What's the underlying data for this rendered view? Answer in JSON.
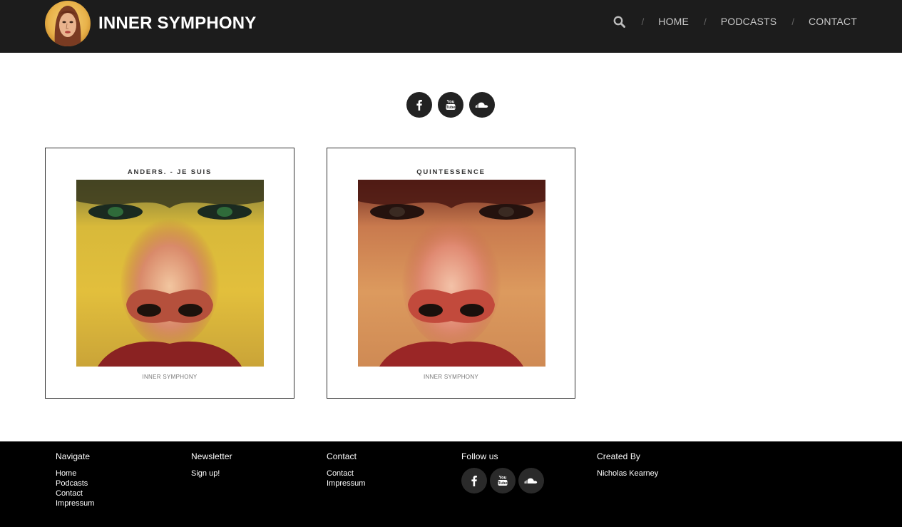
{
  "header": {
    "brand": "INNER SYMPHONY",
    "nav": {
      "home": "HOME",
      "podcasts": "PODCASTS",
      "contact": "CONTACT"
    },
    "separator": "/",
    "search_icon": "search-icon"
  },
  "social": {
    "facebook_icon": "facebook-icon",
    "youtube_icon": "youtube-icon",
    "soundcloud_icon": "soundcloud-icon"
  },
  "podcasts": [
    {
      "title": "ANDERS. - JE SUIS",
      "footer": "INNER SYMPHONY"
    },
    {
      "title": "QUINTESSENCE",
      "footer": "INNER SYMPHONY"
    }
  ],
  "footer": {
    "navigate": {
      "heading": "Navigate",
      "links": [
        "Home",
        "Podcasts",
        "Contact",
        "Impressum"
      ]
    },
    "newsletter": {
      "heading": "Newsletter",
      "link": "Sign up!"
    },
    "contact": {
      "heading": "Contact",
      "links": [
        "Contact",
        "Impressum"
      ]
    },
    "follow": {
      "heading": "Follow us"
    },
    "created": {
      "heading": "Created By",
      "name": "Nicholas Kearney"
    }
  },
  "colors": {
    "header_bg": "#1c1c1c",
    "footer_bg": "#000000",
    "social_bg": "#222222"
  }
}
